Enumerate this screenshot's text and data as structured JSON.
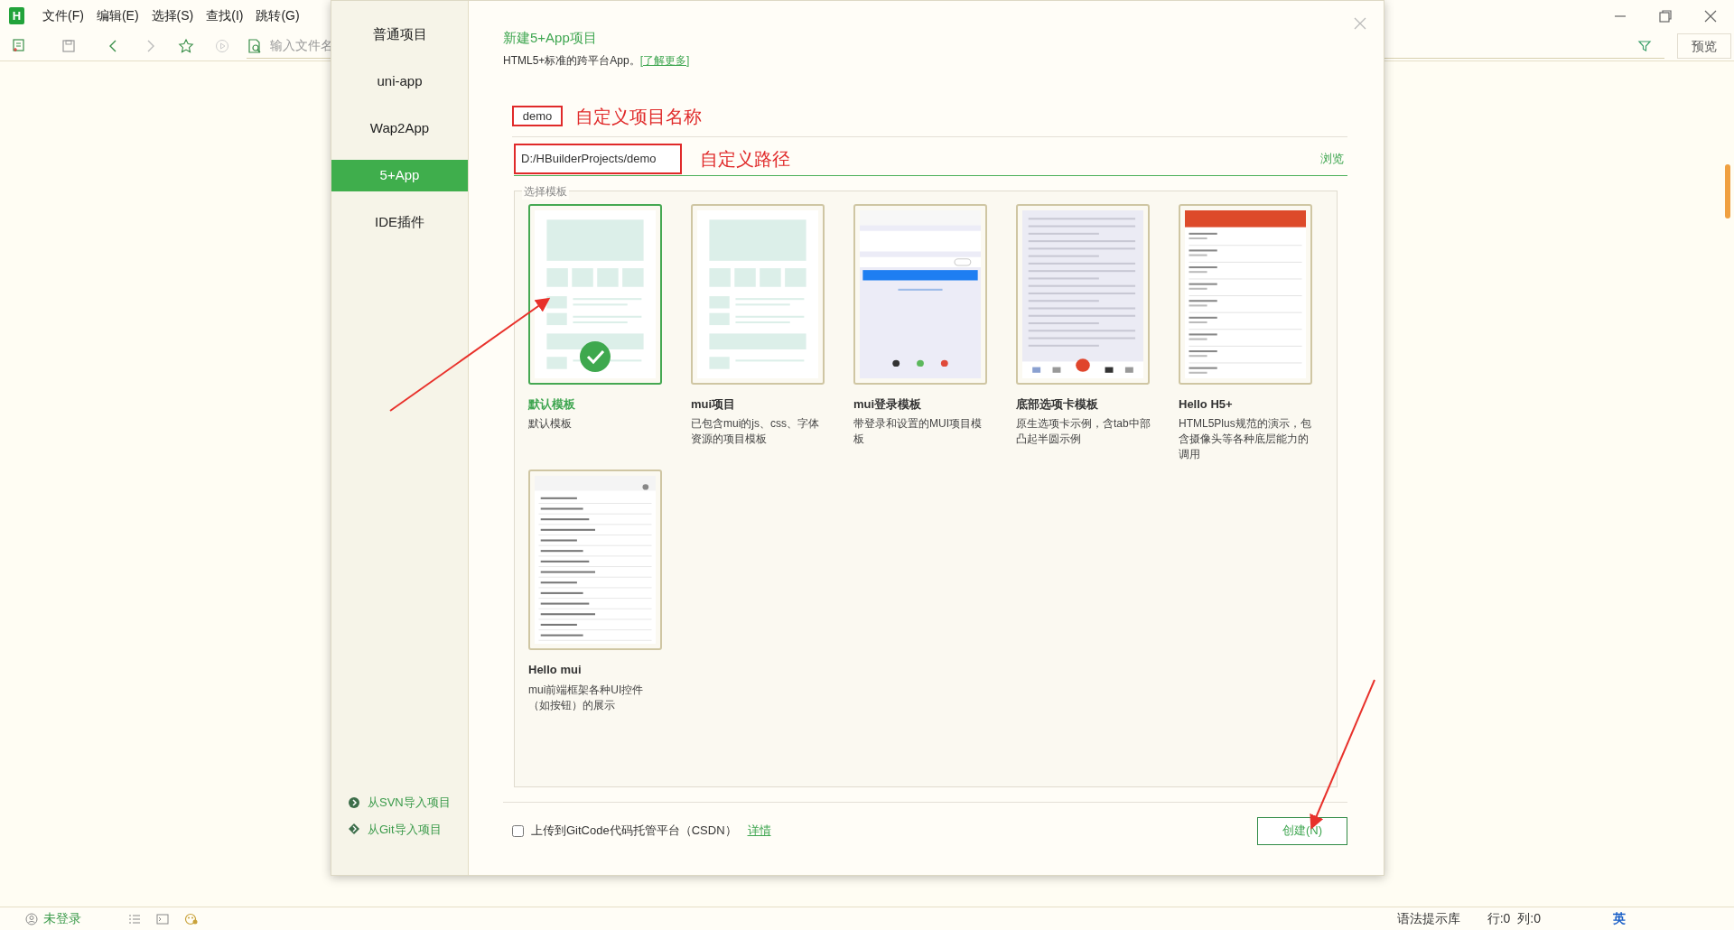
{
  "app": {
    "logo": "H",
    "menu": [
      "文件(F)",
      "编辑(E)",
      "选择(S)",
      "查找(I)",
      "跳转(G)"
    ],
    "file_search": {
      "placeholder": "输入文件名"
    },
    "preview_button": "预览"
  },
  "dialog": {
    "nav": [
      {
        "label": "普通项目",
        "selected": false
      },
      {
        "label": "uni-app",
        "selected": false
      },
      {
        "label": "Wap2App",
        "selected": false
      },
      {
        "label": "5+App",
        "selected": true
      },
      {
        "label": "IDE插件",
        "selected": false
      }
    ],
    "import_links": [
      "从SVN导入项目",
      "从Git导入项目"
    ],
    "title": "新建5+App项目",
    "subtitle": "HTML5+标准的跨平台App。",
    "learn_more": "[了解更多]",
    "project_name": "demo",
    "name_annotation": "自定义项目名称",
    "path": "D:/HBuilderProjects/demo",
    "path_annotation": "自定义路径",
    "browse": "浏览",
    "template_group": "选择模板",
    "templates": [
      {
        "kind": "wireframe",
        "title": "默认模板",
        "description": "默认模板",
        "selected": true
      },
      {
        "kind": "wireframe",
        "title": "mui项目",
        "description": "已包含mui的js、css、字体资源的项目模板",
        "selected": false
      },
      {
        "kind": "login",
        "title": "mui登录模板",
        "description": "带登录和设置的MUI项目模板",
        "selected": false
      },
      {
        "kind": "tabbar",
        "title": "底部选项卡模板",
        "description": "原生选项卡示例，含tab中部凸起半圆示例",
        "selected": false
      },
      {
        "kind": "h5list",
        "title": "Hello H5+",
        "description": "HTML5Plus规范的演示，包含摄像头等各种底层能力的调用",
        "selected": false
      },
      {
        "kind": "muilist",
        "title": "Hello mui",
        "description": "mui前端框架各种UI控件（如按钮）的展示",
        "selected": false
      }
    ],
    "upload": {
      "checked": false,
      "label": "上传到GitCode代码托管平台（CSDN）",
      "link": "详情"
    },
    "create_button": "创建(N)"
  },
  "status_bar": {
    "login": "未登录",
    "syntax": "语法提示库",
    "line": "行:0",
    "column": "列:0",
    "ime": "英"
  }
}
